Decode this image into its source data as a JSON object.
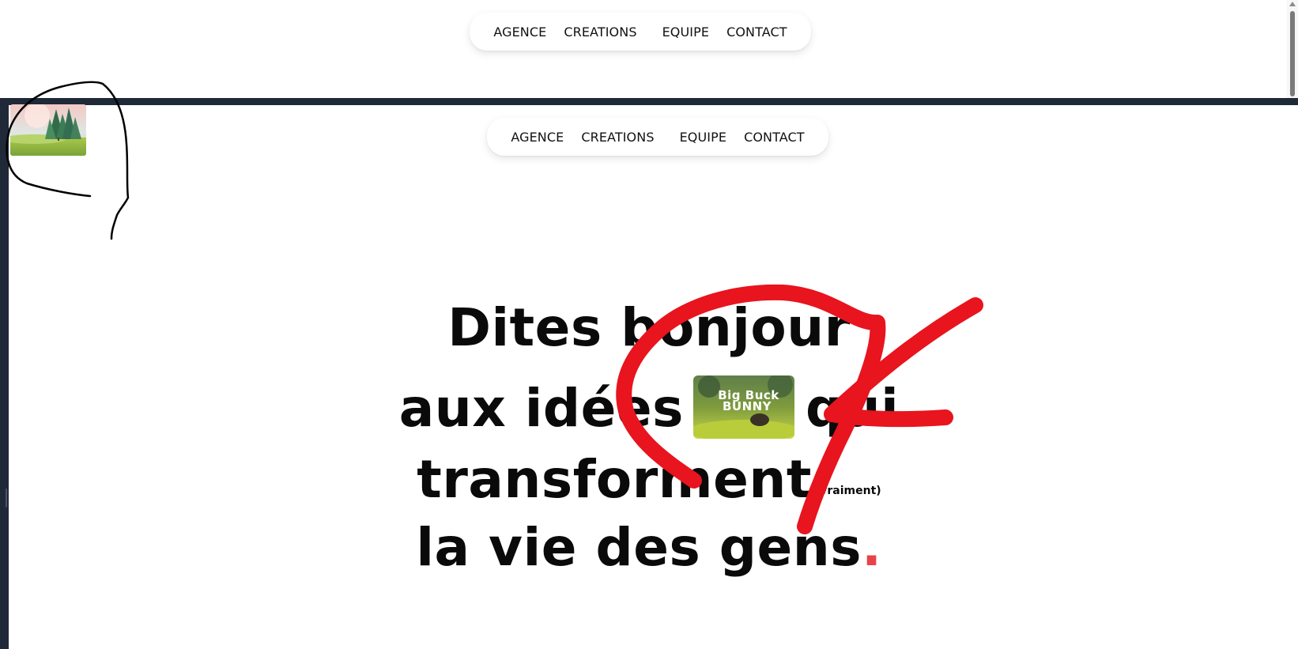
{
  "top_nav": {
    "items": [
      "AGENCE",
      "CREATIONS",
      "EQUIPE",
      "CONTACT"
    ]
  },
  "inner_nav": {
    "items": [
      "AGENCE",
      "CREATIONS",
      "EQUIPE",
      "CONTACT"
    ]
  },
  "hero": {
    "line1": "Dites bonjour",
    "line2_before": "aux idées",
    "line2_after": "qui",
    "line3": "transforment",
    "line3_aside": "(vraiment)",
    "line4": "la vie des gens",
    "line4_dot": ".",
    "video_title_a": "Big Buck",
    "video_title_b": "BUNNY"
  },
  "colors": {
    "accent": "#e8434a",
    "frame": "#1f2937",
    "annotation_red": "#e8141e",
    "annotation_black": "#000000"
  },
  "icons": {
    "scroll_up": "scroll-up-arrow-icon"
  }
}
